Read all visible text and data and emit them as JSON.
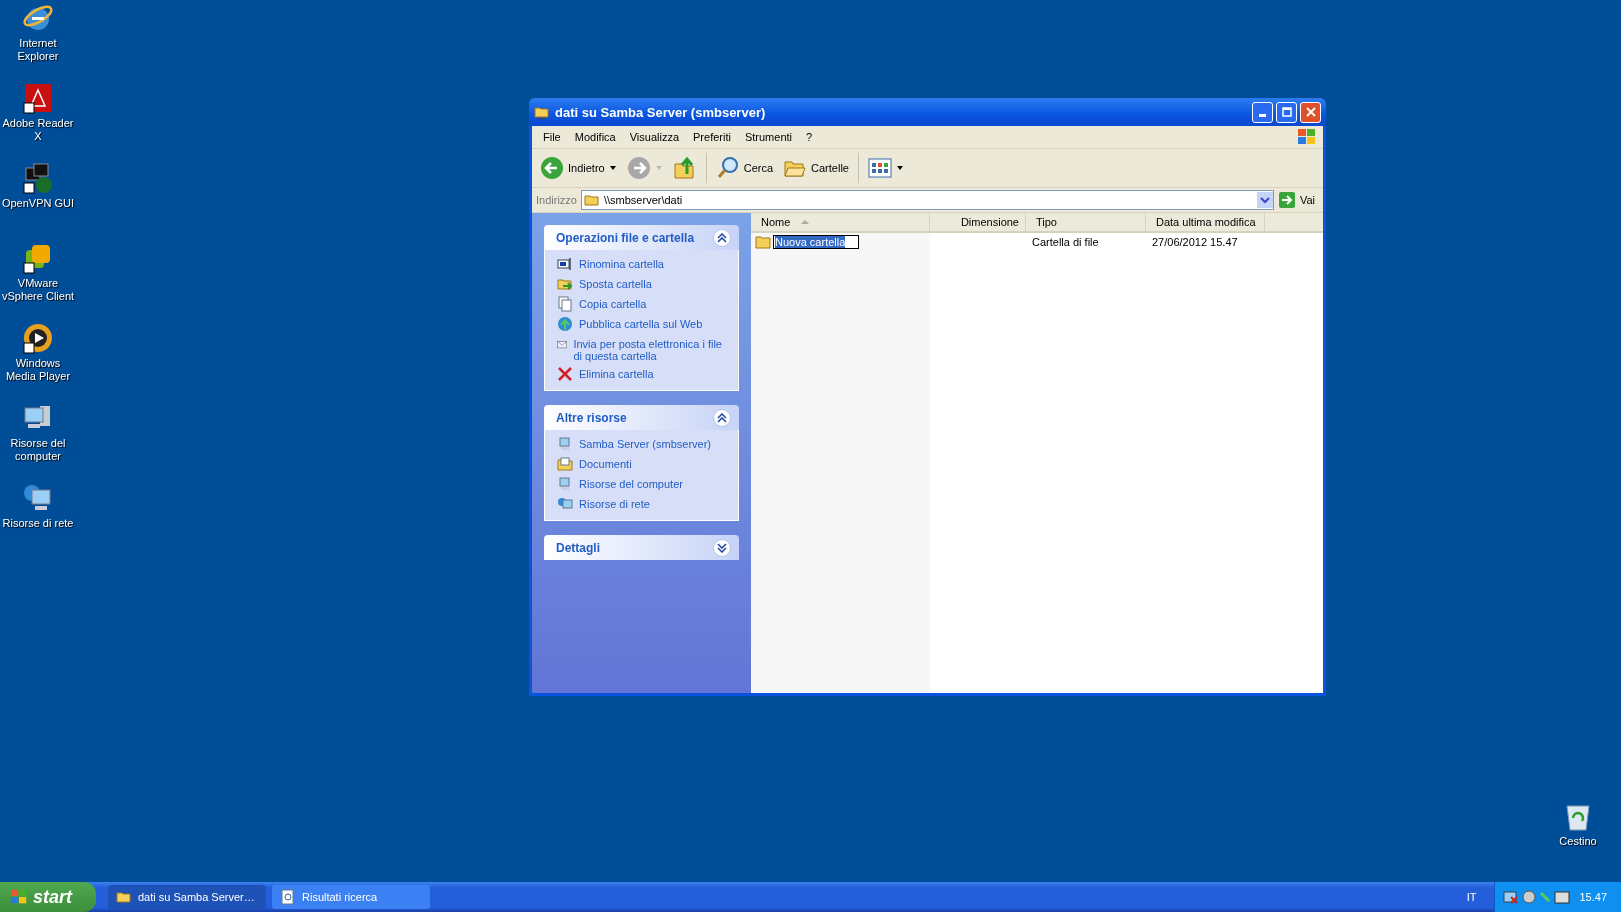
{
  "desktop_icons": [
    {
      "label": "Internet Explorer",
      "kind": "browser"
    },
    {
      "label": "Adobe Reader X",
      "kind": "pdf"
    },
    {
      "label": "OpenVPN GUI",
      "kind": "vpn"
    },
    {
      "label": "VMware vSphere Client",
      "kind": "vmware"
    },
    {
      "label": "Windows Media Player",
      "kind": "media"
    },
    {
      "label": "Risorse del computer",
      "kind": "computer"
    },
    {
      "label": "Risorse di rete",
      "kind": "network"
    }
  ],
  "recycle_bin": {
    "label": "Cestino"
  },
  "window": {
    "title": "dati su Samba Server (smbserver)",
    "menu": [
      "File",
      "Modifica",
      "Visualizza",
      "Preferiti",
      "Strumenti",
      "?"
    ],
    "toolbar": [
      {
        "label": "Indietro",
        "kind": "back"
      },
      {
        "kind": "forward"
      },
      {
        "kind": "up"
      },
      {
        "label": "Cerca",
        "kind": "search"
      },
      {
        "label": "Cartelle",
        "kind": "folders"
      },
      {
        "kind": "views"
      }
    ],
    "address": {
      "label": "Indirizzo",
      "value": "\\\\smbserver\\dati",
      "go": "Vai"
    },
    "panels": [
      {
        "title": "Operazioni file e cartella",
        "expanded": true,
        "items": [
          {
            "label": "Rinomina cartella",
            "kind": "rename"
          },
          {
            "label": "Sposta cartella",
            "kind": "move"
          },
          {
            "label": "Copia cartella",
            "kind": "copy"
          },
          {
            "label": "Pubblica cartella sul Web",
            "kind": "web"
          },
          {
            "label": "Invia per posta elettronica i file di questa cartella",
            "kind": "mail"
          },
          {
            "label": "Elimina cartella",
            "kind": "delete"
          }
        ]
      },
      {
        "title": "Altre risorse",
        "expanded": true,
        "items": [
          {
            "label": "Samba Server (smbserver)",
            "kind": "computer"
          },
          {
            "label": "Documenti",
            "kind": "documents"
          },
          {
            "label": "Risorse del computer",
            "kind": "computer"
          },
          {
            "label": "Risorse di rete",
            "kind": "network"
          }
        ]
      },
      {
        "title": "Dettagli",
        "expanded": false
      }
    ],
    "columns": [
      {
        "label": "Nome",
        "sorted": true
      },
      {
        "label": "Dimensione",
        "sorted": false
      },
      {
        "label": "Tipo",
        "sorted": false
      },
      {
        "label": "Data ultima modifica",
        "sorted": false
      }
    ],
    "rows": [
      {
        "name": "Nuova cartella",
        "type": "Cartella di file",
        "modified": "27/06/2012 15.47",
        "editing": true
      }
    ]
  },
  "taskbar": {
    "start": "start",
    "tasks": [
      {
        "label": "dati su Samba Server…",
        "kind": "explorer",
        "selected": true
      },
      {
        "label": "Risultati ricerca",
        "kind": "search",
        "selected": false
      }
    ],
    "language": "IT",
    "clock": "15.47"
  }
}
